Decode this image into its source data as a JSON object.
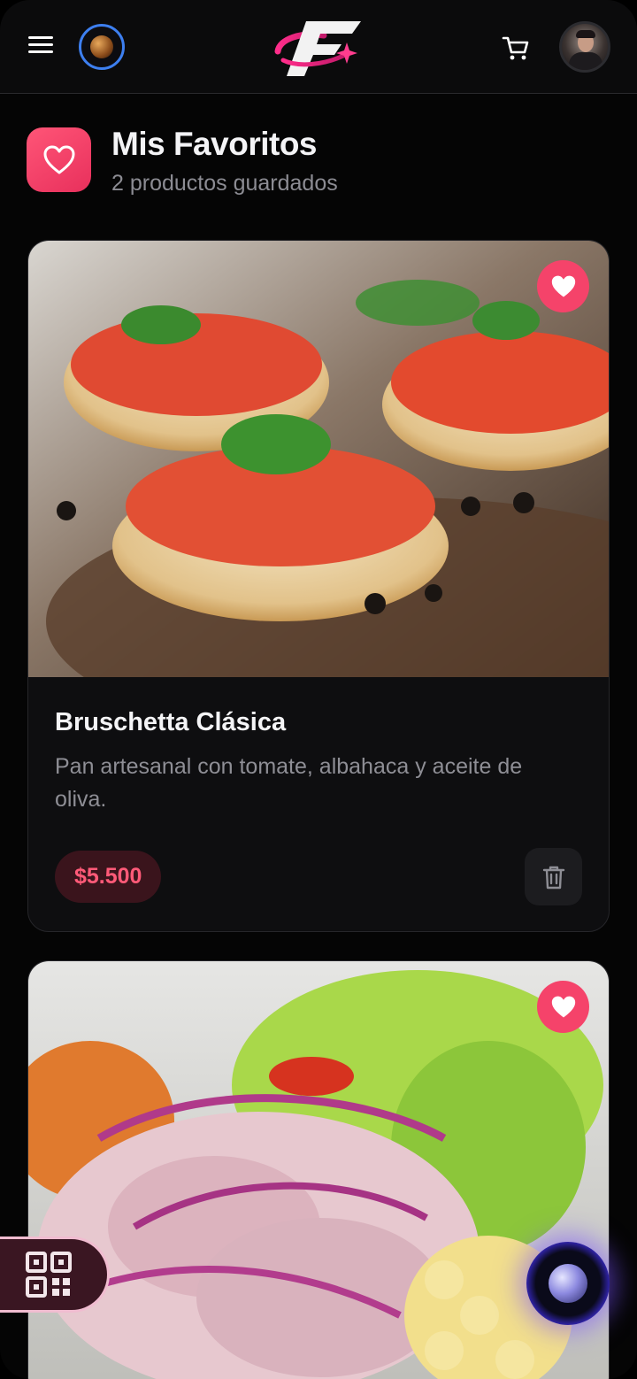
{
  "header": {
    "icons": [
      "menu-icon",
      "planet-icon",
      "brand-logo",
      "cart-icon",
      "user-avatar"
    ]
  },
  "page": {
    "title": "Mis Favoritos",
    "subtitle": "2 productos guardados"
  },
  "products": [
    {
      "name": "Bruschetta Clásica",
      "description": "Pan artesanal con tomate, albahaca y aceite de oliva.",
      "price": "$5.500",
      "favorite": true
    },
    {
      "name": "",
      "description": "",
      "price": "",
      "favorite": true
    }
  ],
  "colors": {
    "accent": "#f5436a",
    "background": "#050505",
    "card": "#0e0e10",
    "price_bg": "#3a141c",
    "price_text": "#ff5a78"
  }
}
